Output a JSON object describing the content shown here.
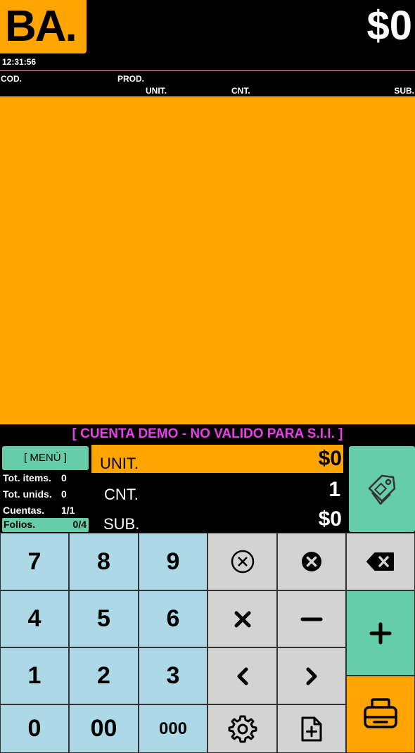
{
  "header": {
    "logo_text": "BA.",
    "total": "$0",
    "clock": "12:31:56"
  },
  "columns": {
    "cod": "COD.",
    "prod": "PROD.",
    "unit": "UNIT.",
    "cnt": "CNT.",
    "sub": "SUB."
  },
  "banner": "[ CUENTA DEMO - NO VALIDO PARA S.I.I. ]",
  "menu_label": "[ MENÚ ]",
  "stats": {
    "items_label": "Tot. items.",
    "items_value": "0",
    "unids_label": "Tot. unids.",
    "unids_value": "0",
    "cuentas_label": "Cuentas.",
    "cuentas_value": "1/1",
    "folios_label": "Folios.",
    "folios_value": "0/4"
  },
  "fields": {
    "unit_label": "UNIT.",
    "unit_value": "$0",
    "cnt_label": "CNT.",
    "cnt_value": "1",
    "sub_label": "SUB.",
    "sub_value": "$0"
  },
  "keypad": {
    "k7": "7",
    "k8": "8",
    "k9": "9",
    "k4": "4",
    "k5": "5",
    "k6": "6",
    "k1": "1",
    "k2": "2",
    "k3": "3",
    "k0": "0",
    "k00": "00",
    "k000": "000"
  },
  "icons": {
    "clear_circle": "x-circle-outline-icon",
    "clear_filled": "x-circle-filled-icon",
    "backspace": "backspace-icon",
    "multiply": "multiply-icon",
    "minus": "minus-icon",
    "plus": "plus-icon",
    "left": "chevron-left-icon",
    "right": "chevron-right-icon",
    "settings": "gear-icon",
    "add_document": "file-plus-icon",
    "print": "printer-icon",
    "tag": "price-tag-icon"
  },
  "colors": {
    "accent_orange": "#FFA500",
    "accent_green": "#66CDAA",
    "key_blue": "#ADD8E6",
    "key_gray": "#D3D3D3",
    "demo_magenta": "#E640E6"
  }
}
